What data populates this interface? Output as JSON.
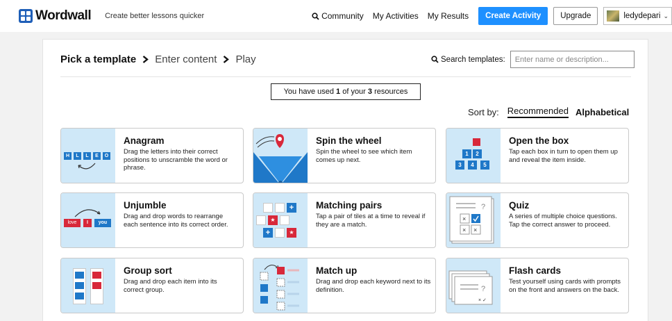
{
  "header": {
    "logo_text": "Wordwall",
    "tagline": "Create better lessons quicker",
    "nav": {
      "community": "Community",
      "my_activities": "My Activities",
      "my_results": "My Results",
      "create_activity": "Create Activity",
      "upgrade": "Upgrade",
      "username": "ledydepari"
    }
  },
  "breadcrumb": {
    "step1": "Pick a template",
    "step2": "Enter content",
    "step3": "Play"
  },
  "search": {
    "label": "Search templates:",
    "placeholder": "Enter name or description..."
  },
  "usage": {
    "prefix": "You have used ",
    "used": "1",
    "middle": " of your ",
    "limit": "3",
    "suffix": " resources"
  },
  "sort": {
    "label": "Sort by:",
    "recommended": "Recommended",
    "alphabetical": "Alphabetical",
    "selected": "Recommended"
  },
  "templates": [
    {
      "title": "Anagram",
      "description": "Drag the letters into their correct positions to unscramble the word or phrase.",
      "thumb_letters": [
        "H",
        "L",
        "L",
        "E",
        "O"
      ]
    },
    {
      "title": "Spin the wheel",
      "description": "Spin the wheel to see which item comes up next."
    },
    {
      "title": "Open the box",
      "description": "Tap each box in turn to open them up and reveal the item inside.",
      "thumb_numbers": [
        "1",
        "2",
        "3",
        "4",
        "5"
      ]
    },
    {
      "title": "Unjumble",
      "description": "Drag and drop words to rearrange each sentence into its correct order.",
      "thumb_words": [
        "love",
        "I",
        "you"
      ]
    },
    {
      "title": "Matching pairs",
      "description": "Tap a pair of tiles at a time to reveal if they are a match."
    },
    {
      "title": "Quiz",
      "description": "A series of multiple choice questions. Tap the correct answer to proceed."
    },
    {
      "title": "Group sort",
      "description": "Drag and drop each item into its correct group."
    },
    {
      "title": "Match up",
      "description": "Drag and drop each keyword next to its definition."
    },
    {
      "title": "Flash cards",
      "description": "Test yourself using cards with prompts on the front and answers on the back."
    }
  ],
  "colors": {
    "brand_blue": "#1e90ff",
    "thumb_bg": "#cfe8f8",
    "tile_blue": "#1f78c8",
    "tile_red": "#d8283a"
  }
}
